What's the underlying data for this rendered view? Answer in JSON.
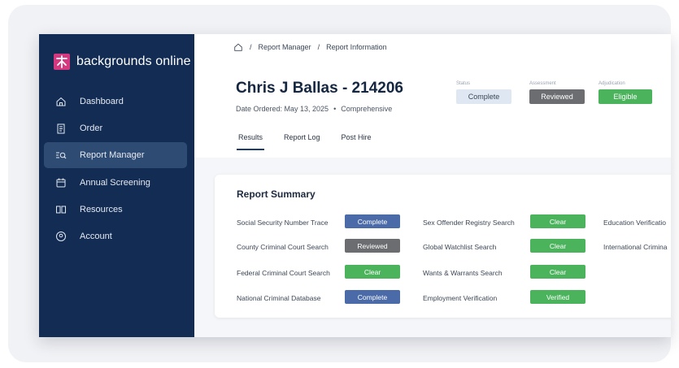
{
  "brand": {
    "name": "backgrounds online"
  },
  "sidebar": {
    "items": [
      {
        "label": "Dashboard",
        "icon": "home-icon"
      },
      {
        "label": "Order",
        "icon": "clipboard-icon"
      },
      {
        "label": "Report Manager",
        "icon": "search-list-icon",
        "active": true
      },
      {
        "label": "Annual Screening",
        "icon": "calendar-icon"
      },
      {
        "label": "Resources",
        "icon": "book-icon"
      },
      {
        "label": "Account",
        "icon": "user-icon"
      }
    ]
  },
  "breadcrumb": {
    "first": "Report Manager",
    "second": "Report Information",
    "separator": "/"
  },
  "report": {
    "title": "Chris J Ballas - 214206",
    "date_ordered": "Date Ordered: May 13, 2025",
    "separator": "•",
    "package": "Comprehensive"
  },
  "status": {
    "status_label": "Status",
    "status_value": "Complete",
    "assessment_label": "Assessment",
    "assessment_value": "Reviewed",
    "adjudication_label": "Adjudication",
    "adjudication_value": "Eligible"
  },
  "tabs": [
    "Results",
    "Report Log",
    "Post Hire"
  ],
  "summary": {
    "title": "Report Summary",
    "col1": [
      {
        "label": "Social Security Number Trace",
        "status": "Complete"
      },
      {
        "label": "County Criminal Court Search",
        "status": "Reviewed"
      },
      {
        "label": "Federal Criminal Court Search",
        "status": "Clear"
      },
      {
        "label": "National Criminal Database",
        "status": "Complete"
      }
    ],
    "col2": [
      {
        "label": "Sex Offender Registry Search",
        "status": "Clear"
      },
      {
        "label": "Global Watchlist Search",
        "status": "Clear"
      },
      {
        "label": "Wants & Warrants Search",
        "status": "Clear"
      },
      {
        "label": "Employment Verification",
        "status": "Verified"
      }
    ],
    "col3": [
      {
        "label": "Education Verificatio"
      },
      {
        "label": "International Crimina"
      }
    ]
  },
  "colors": {
    "sidebar": "#122c54",
    "active_nav": "#2e4b73",
    "complete": "#4a6aa8",
    "reviewed": "#6b6d70",
    "clear": "#4ab35c"
  }
}
